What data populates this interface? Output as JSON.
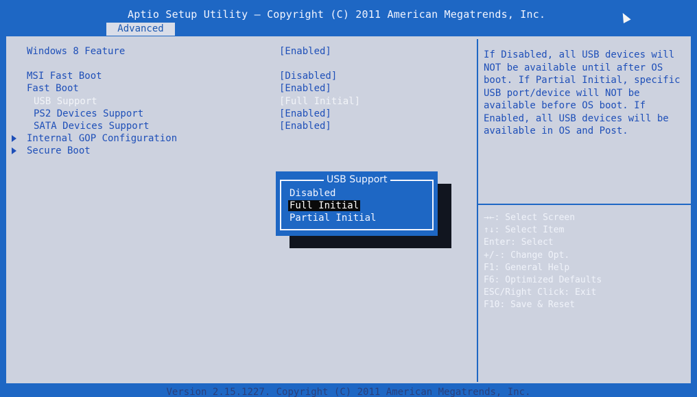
{
  "header": {
    "title": "Aptio Setup Utility – Copyright (C) 2011 American Megatrends, Inc.",
    "active_tab": "Advanced"
  },
  "settings": [
    {
      "label": "Windows 8 Feature",
      "value": "[Enabled]",
      "state": "normal"
    },
    {
      "label": "MSI Fast Boot",
      "value": "[Disabled]",
      "state": "normal"
    },
    {
      "label": "Fast Boot",
      "value": "[Enabled]",
      "state": "normal"
    },
    {
      "label": "USB Support",
      "value": "[Full Initial]",
      "state": "highlighted"
    },
    {
      "label": "PS2 Devices Support",
      "value": "[Enabled]",
      "state": "normal"
    },
    {
      "label": "SATA Devices Support",
      "value": "[Enabled]",
      "state": "normal"
    },
    {
      "label": "Internal GOP Configuration",
      "value": "",
      "state": "submenu"
    },
    {
      "label": "Secure Boot",
      "value": "",
      "state": "submenu"
    }
  ],
  "help": {
    "description": "If Disabled, all USB devices will NOT be available until after OS boot. If Partial Initial, specific USB port/device will NOT be available before OS boot. If Enabled, all USB devices will be available in OS and Post.",
    "keys": [
      "→←: Select Screen",
      "↑↓: Select Item",
      "Enter: Select",
      "+/-: Change Opt.",
      "F1: General Help",
      "F6: Optimized Defaults",
      "ESC/Right Click: Exit",
      "F10: Save & Reset"
    ]
  },
  "popup": {
    "title": "USB Support",
    "options": [
      "Disabled",
      "Full Initial",
      "Partial Initial"
    ],
    "selected": "Full Initial"
  },
  "footer": {
    "version": "Version 2.15.1227. Copyright (C) 2011 American Megatrends, Inc."
  },
  "colors": {
    "frame_blue": "#1e67c4",
    "panel_gray": "#cdd2df",
    "text_blue": "#1e4fb8",
    "highlight_white": "#f2f4f8"
  }
}
